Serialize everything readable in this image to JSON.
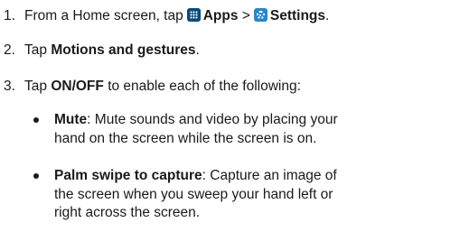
{
  "steps": [
    {
      "number": "1.",
      "prefix": "From a Home screen, tap",
      "apps_label": "Apps",
      "separator": ">",
      "settings_label": "Settings",
      "suffix": "."
    },
    {
      "number": "2.",
      "prefix": "Tap",
      "bold": "Motions and gestures",
      "suffix": "."
    },
    {
      "number": "3.",
      "prefix": "Tap",
      "bold": "ON/OFF",
      "suffix": "to enable each of the following:"
    }
  ],
  "bullets": [
    {
      "term": "Mute",
      "lines": [
        ": Mute sounds and video by placing your",
        "hand on the screen while the screen is on."
      ]
    },
    {
      "term": "Palm swipe to capture",
      "lines": [
        ": Capture an image of",
        "the screen when you sweep your hand left or",
        "right across the screen."
      ]
    }
  ],
  "icons": {
    "apps": "apps-grid-icon",
    "settings": "settings-gear-icon"
  },
  "colors": {
    "apps_icon": "#0a4a7a",
    "settings_icon": "#2a86c6",
    "text": "#1a1a1a"
  }
}
